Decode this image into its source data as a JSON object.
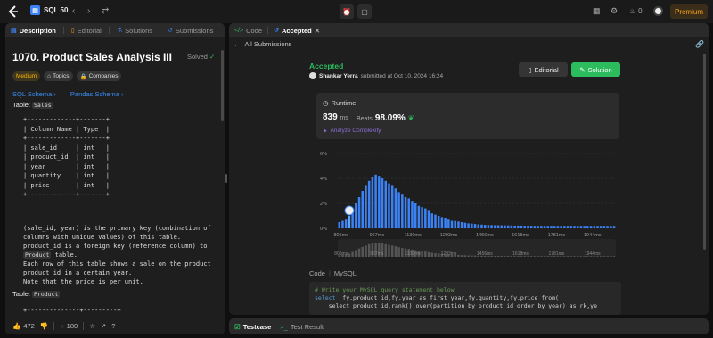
{
  "topbar": {
    "list_label": "SQL 50",
    "list_icon": "sql-list-icon",
    "streak_count": "0",
    "premium_label": "Premium",
    "accent_color": "#ffa116"
  },
  "left": {
    "tabs": [
      {
        "label": "Description",
        "icon": "document-icon"
      },
      {
        "label": "Editorial",
        "icon": "book-icon"
      },
      {
        "label": "Solutions",
        "icon": "flask-icon"
      },
      {
        "label": "Submissions",
        "icon": "history-icon"
      }
    ],
    "problem_title": "1070. Product Sales Analysis III",
    "solved_label": "Solved",
    "difficulty": "Medium",
    "topics_label": "Topics",
    "companies_label": "Companies",
    "schema_links": [
      "SQL Schema",
      "Pandas Schema"
    ],
    "table_prefix": "Table:",
    "table_sales": "Sales",
    "sales_schema": "+-------------+-------+\n| Column Name | Type  |\n+-------------+-------+\n| sale_id     | int   |\n| product_id  | int   |\n| year        | int   |\n| quantity    | int   |\n| price       | int   |\n+-------------+-------+",
    "desc_line1": "(sale_id, year) is the primary key (combination of columns with unique values) of this table.",
    "desc_line2a": "product_id is a foreign key (reference column) to",
    "desc_line2_code": "Product",
    "desc_line2b": "table.",
    "desc_line3": "Each row of this table shows a sale on the product product_id in a certain year.",
    "desc_line4": "Note that the price is per unit.",
    "table_product": "Product",
    "product_schema_top": "+--------------+---------+",
    "likes": "472",
    "comments": "180"
  },
  "right": {
    "tabs": [
      {
        "label": "Code",
        "icon": "code-icon"
      },
      {
        "label": "Accepted",
        "icon": "history-icon"
      }
    ],
    "back_label": "All Submissions",
    "status": "Accepted",
    "submitter": "Shankar Yerra",
    "submitted_text": "submitted at Oct 10, 2024 16:24",
    "editorial_btn": "Editorial",
    "solution_btn": "Solution",
    "runtime_label": "Runtime",
    "runtime_value": "839",
    "runtime_unit": "ms",
    "beats_label": "Beats",
    "beats_value": "98.09%",
    "analyze_label": "Analyze Complexity",
    "code_label": "Code",
    "language": "MySQL",
    "code_comment": "# Write your MySQL query statement below",
    "code_line2_kw": "select",
    "code_line2_rest": "  fy.product_id,fy.year as first_year,fy.quantity,fy.price from(",
    "code_line3": "    select product_id,rank() over(partition by product_id order by year) as rk,ye"
  },
  "bottom": {
    "testcase_label": "Testcase",
    "result_label": "Test Result"
  },
  "chart_data": {
    "type": "bar",
    "title": "",
    "ylabel": "",
    "y_unit": "%",
    "y_ticks": [
      "6%",
      "4%",
      "2%",
      "0%"
    ],
    "ylim": [
      0,
      6
    ],
    "x_ticks": [
      "805ms",
      "967ms",
      "1130ms",
      "1293ms",
      "1456ms",
      "1618ms",
      "1781ms",
      "1944ms"
    ],
    "xlim": [
      790,
      2050
    ],
    "user_runtime_ms": 839,
    "bin_width_ms": 15,
    "bins_start_ms": 790,
    "values": [
      0.5,
      0.6,
      0.7,
      1.0,
      1.5,
      2.0,
      2.5,
      3.0,
      3.4,
      3.8,
      4.1,
      4.3,
      4.2,
      4.0,
      3.8,
      3.6,
      3.4,
      3.2,
      2.9,
      2.7,
      2.5,
      2.4,
      2.2,
      2.0,
      1.8,
      1.7,
      1.6,
      1.4,
      1.2,
      1.1,
      1.0,
      0.9,
      0.8,
      0.7,
      0.6,
      0.6,
      0.55,
      0.5,
      0.45,
      0.4,
      0.38,
      0.35,
      0.32,
      0.3,
      0.28,
      0.27,
      0.26,
      0.25,
      0.25,
      0.24,
      0.24,
      0.23,
      0.23,
      0.22,
      0.22,
      0.22,
      0.21,
      0.21,
      0.21,
      0.2,
      0.2,
      0.2,
      0.2,
      0.2,
      0.2,
      0.2,
      0.2,
      0.2,
      0.2,
      0.2,
      0.2,
      0.2,
      0.2,
      0.2,
      0.2,
      0.2,
      0.2,
      0.2,
      0.2,
      0.2,
      0.2,
      0.2,
      0.2,
      0.2
    ],
    "bar_color": "#3b82f6",
    "highlight_bar_color": "#60a5fa"
  }
}
